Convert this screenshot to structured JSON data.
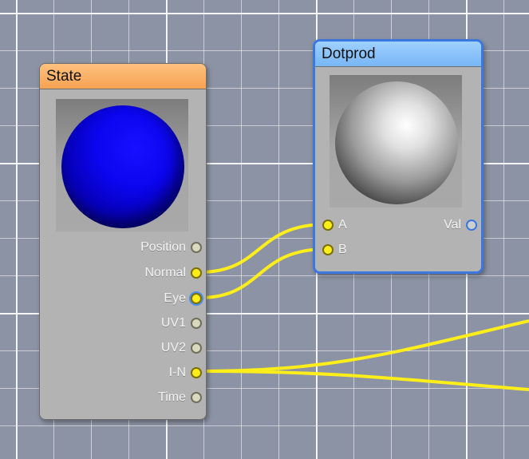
{
  "nodes": {
    "state": {
      "title": "State",
      "outputs": [
        {
          "label": "Position",
          "connected": false
        },
        {
          "label": "Normal",
          "connected": true
        },
        {
          "label": "Eye",
          "connected": true
        },
        {
          "label": "UV1",
          "connected": false
        },
        {
          "label": "UV2",
          "connected": false
        },
        {
          "label": "I-N",
          "connected": true
        },
        {
          "label": "Time",
          "connected": false
        }
      ]
    },
    "dotprod": {
      "title": "Dotprod",
      "selected": true,
      "inputs": [
        {
          "label": "A",
          "connected": true
        },
        {
          "label": "B",
          "connected": true
        }
      ],
      "outputs": [
        {
          "label": "Val",
          "connected": false
        }
      ]
    }
  },
  "connections": [
    {
      "from": "State.Normal",
      "to": "Dotprod.A"
    },
    {
      "from": "State.Eye",
      "to": "Dotprod.B"
    },
    {
      "from": "State.I-N",
      "to": "offscreen-node"
    },
    {
      "from": "State.I-N",
      "to": "offscreen-node"
    }
  ],
  "colors": {
    "canvas": "#8c93a4",
    "wire": "#ffee1a",
    "state_header": "#f6a353",
    "dotprod_header": "#78b6f6",
    "selection": "#3a78e0"
  }
}
